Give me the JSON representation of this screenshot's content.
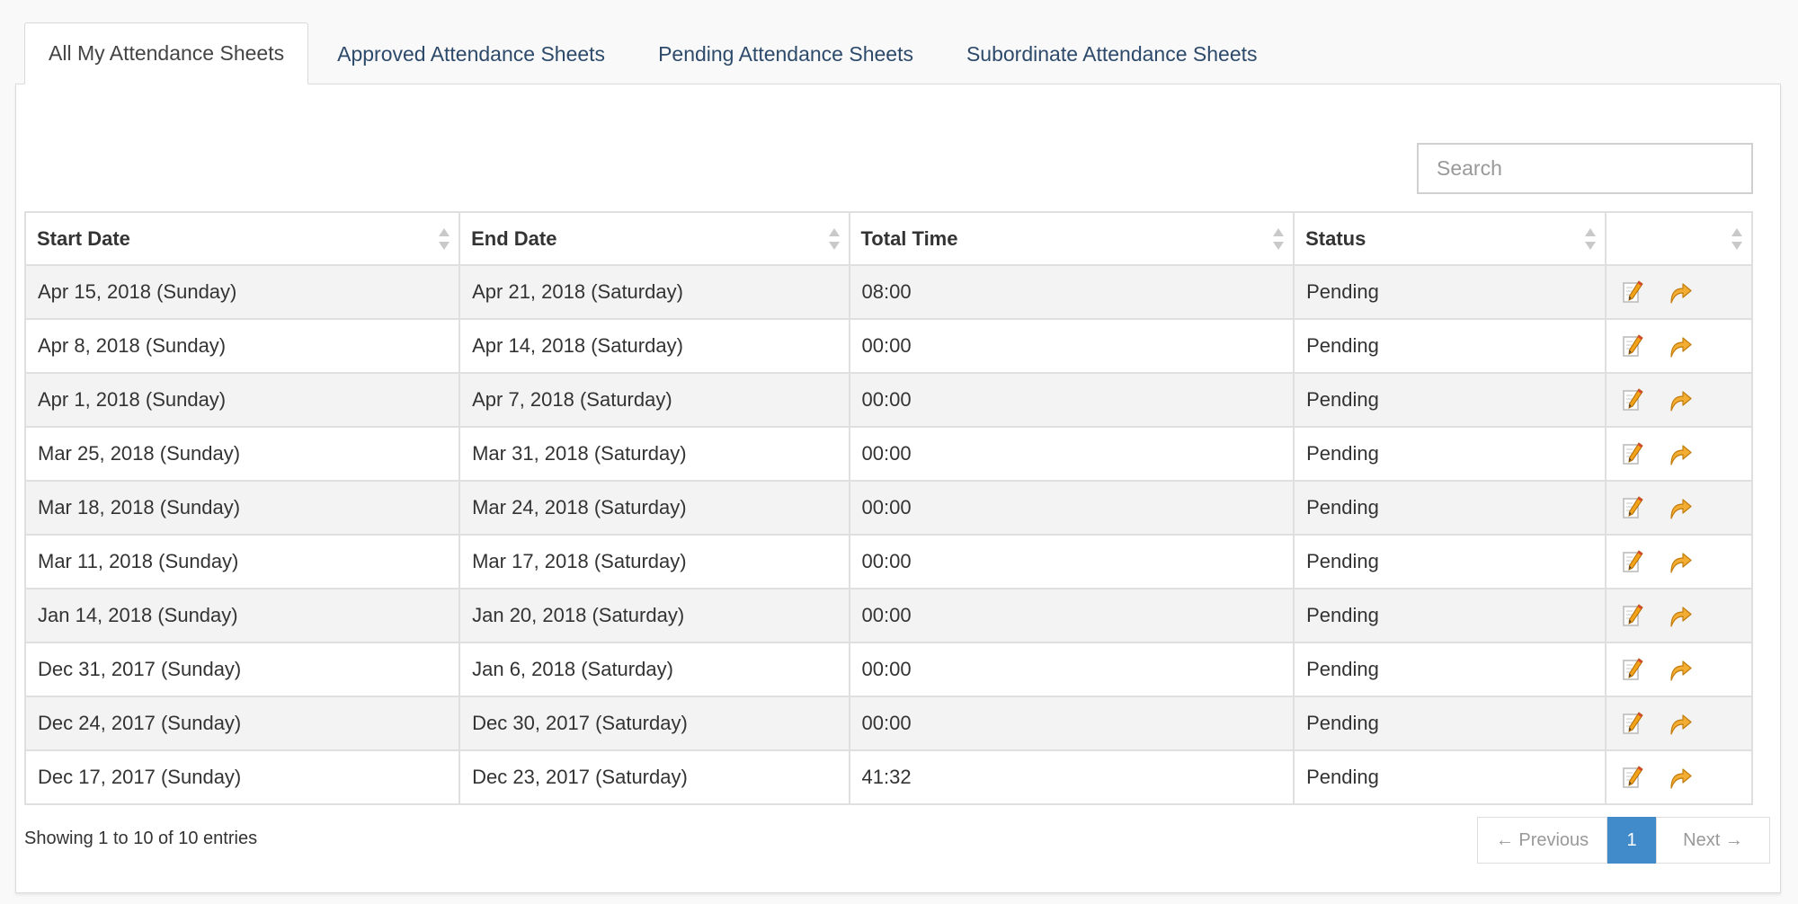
{
  "tabs": [
    {
      "label": "All My Attendance Sheets",
      "active": true
    },
    {
      "label": "Approved Attendance Sheets",
      "active": false
    },
    {
      "label": "Pending Attendance Sheets",
      "active": false
    },
    {
      "label": "Subordinate Attendance Sheets",
      "active": false
    }
  ],
  "search": {
    "placeholder": "Search",
    "value": ""
  },
  "table": {
    "headers": [
      "Start Date",
      "End Date",
      "Total Time",
      "Status",
      ""
    ],
    "rows": [
      {
        "start": "Apr 15, 2018 (Sunday)",
        "end": "Apr 21, 2018 (Saturday)",
        "total": "08:00",
        "status": "Pending"
      },
      {
        "start": "Apr 8, 2018 (Sunday)",
        "end": "Apr 14, 2018 (Saturday)",
        "total": "00:00",
        "status": "Pending"
      },
      {
        "start": "Apr 1, 2018 (Sunday)",
        "end": "Apr 7, 2018 (Saturday)",
        "total": "00:00",
        "status": "Pending"
      },
      {
        "start": "Mar 25, 2018 (Sunday)",
        "end": "Mar 31, 2018 (Saturday)",
        "total": "00:00",
        "status": "Pending"
      },
      {
        "start": "Mar 18, 2018 (Sunday)",
        "end": "Mar 24, 2018 (Saturday)",
        "total": "00:00",
        "status": "Pending"
      },
      {
        "start": "Mar 11, 2018 (Sunday)",
        "end": "Mar 17, 2018 (Saturday)",
        "total": "00:00",
        "status": "Pending"
      },
      {
        "start": "Jan 14, 2018 (Sunday)",
        "end": "Jan 20, 2018 (Saturday)",
        "total": "00:00",
        "status": "Pending"
      },
      {
        "start": "Dec 31, 2017 (Sunday)",
        "end": "Jan 6, 2018 (Saturday)",
        "total": "00:00",
        "status": "Pending"
      },
      {
        "start": "Dec 24, 2017 (Sunday)",
        "end": "Dec 30, 2017 (Saturday)",
        "total": "00:00",
        "status": "Pending"
      },
      {
        "start": "Dec 17, 2017 (Sunday)",
        "end": "Dec 23, 2017 (Saturday)",
        "total": "41:32",
        "status": "Pending"
      }
    ],
    "row_actions": [
      "edit-icon",
      "submit-arrow-icon"
    ]
  },
  "footer": {
    "info": "Showing 1 to 10 of 10 entries",
    "prev_label": "← Previous",
    "current_page": "1",
    "next_label": "Next →"
  },
  "colors": {
    "tab_text": "#2d4a6b",
    "pager_active": "#428bca",
    "row_stripe": "#f3f3f4"
  }
}
